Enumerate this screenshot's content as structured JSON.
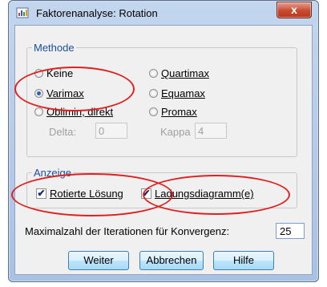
{
  "window": {
    "title": "Faktorenanalyse: Rotation",
    "close_label": "x"
  },
  "methode": {
    "legend": "Methode",
    "options": [
      {
        "label": "Keine",
        "checked": false
      },
      {
        "label": "Varimax",
        "checked": true
      },
      {
        "label": "Oblimin, direkt",
        "checked": false
      },
      {
        "label": "Quartimax",
        "checked": false
      },
      {
        "label": "Equamax",
        "checked": false
      },
      {
        "label": "Promax",
        "checked": false
      }
    ],
    "delta_label": "Delta:",
    "delta_value": "0",
    "kappa_label": "Kappa",
    "kappa_value": "4"
  },
  "anzeige": {
    "legend": "Anzeige",
    "rotierte_loesung": {
      "label": "Rotierte Lösung",
      "checked": true
    },
    "ladungsdiagramm": {
      "label": "Ladungsdiagramm(e)",
      "checked": true
    }
  },
  "iterations": {
    "label": "Maximalzahl der Iterationen für Konvergenz:",
    "value": "25"
  },
  "buttons": {
    "weiter": "Weiter",
    "abbrechen": "Abbrechen",
    "hilfe": "Hilfe"
  },
  "colors": {
    "annotation": "#e02020",
    "legend_text": "#1c4fa0"
  }
}
